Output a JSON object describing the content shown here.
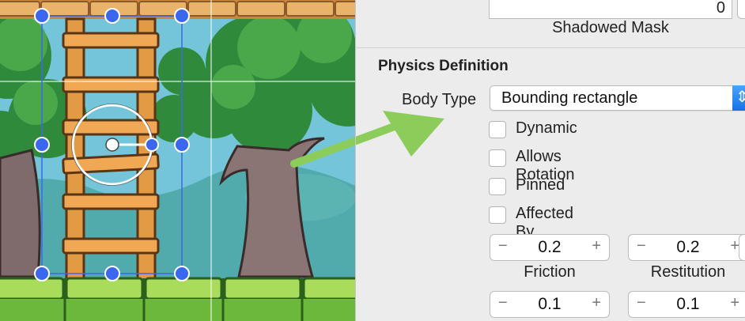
{
  "editor": {
    "selected_sprite": "ladder"
  },
  "inspector": {
    "shadowed_mask": {
      "value": "0",
      "caption": "Shadowed Mask"
    },
    "physics": {
      "section_title": "Physics Definition",
      "body_type_label": "Body Type",
      "body_type_value": "Bounding rectangle",
      "popup_arrow": "⇕",
      "checkboxes": [
        {
          "label": "Dynamic",
          "checked": false
        },
        {
          "label": "Allows Rotation",
          "checked": false
        },
        {
          "label": "Pinned",
          "checked": false
        },
        {
          "label": "Affected By Gravity",
          "checked": false
        }
      ],
      "friction": {
        "value": "0.2",
        "label": "Friction"
      },
      "restitution": {
        "value": "0.2",
        "label": "Restitution"
      },
      "row3_left": {
        "value": "0.1"
      },
      "row3_right": {
        "value": "0.1"
      },
      "minus_glyph": "−",
      "plus_glyph": "+"
    }
  },
  "annotation": {
    "arrow_color": "#8ccc5a"
  },
  "colors": {
    "selection_blue": "#3b67ee",
    "leaf_green": "#3e8a3a",
    "wood": "#e8a04e"
  }
}
